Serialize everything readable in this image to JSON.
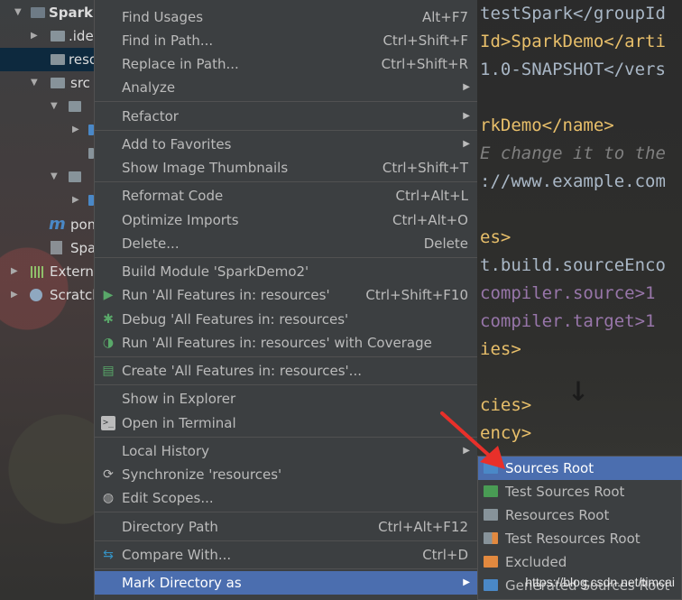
{
  "project_tree": {
    "items": [
      {
        "label": "SparkD",
        "icon": "project-folder-icon",
        "expanded": true,
        "selected": false
      },
      {
        "label": ".ide",
        "icon": "folder-icon",
        "expanded": false,
        "selected": false
      },
      {
        "label": "reso",
        "icon": "folder-icon",
        "expanded": false,
        "selected": true
      },
      {
        "label": "src",
        "icon": "folder-icon",
        "expanded": true,
        "selected": false
      },
      {
        "label": "pom",
        "icon": "maven-icon",
        "selected": false
      },
      {
        "label": "Spa",
        "icon": "file-icon",
        "selected": false
      },
      {
        "label": "Externa",
        "icon": "libraries-icon",
        "selected": false
      },
      {
        "label": "Scratch",
        "icon": "scratches-icon",
        "selected": false
      }
    ]
  },
  "editor": {
    "lines": [
      "testSpark</groupId",
      "Id>SparkDemo</arti",
      "1.0-SNAPSHOT</vers",
      "rkDemo</name>",
      "E change it to the",
      "://www.example.com",
      "es>",
      "t.build.sourceEnco",
      "compiler.source>1",
      "compiler.target>1",
      "ies>",
      "cies>",
      "ency>"
    ]
  },
  "context_menu": {
    "items": [
      {
        "label": "Find Usages",
        "shortcut": "Alt+F7"
      },
      {
        "label": "Find in Path...",
        "shortcut": "Ctrl+Shift+F"
      },
      {
        "label": "Replace in Path...",
        "shortcut": "Ctrl+Shift+R"
      },
      {
        "label": "Analyze",
        "shortcut": "",
        "submenu": true
      },
      {
        "label": "Refactor",
        "shortcut": "",
        "submenu": true
      },
      {
        "label": "Add to Favorites",
        "shortcut": "",
        "submenu": true
      },
      {
        "label": "Show Image Thumbnails",
        "shortcut": "Ctrl+Shift+T"
      },
      {
        "label": "Reformat Code",
        "shortcut": "Ctrl+Alt+L"
      },
      {
        "label": "Optimize Imports",
        "shortcut": "Ctrl+Alt+O"
      },
      {
        "label": "Delete...",
        "shortcut": "Delete"
      },
      {
        "label": "Build Module 'SparkDemo2'",
        "shortcut": ""
      },
      {
        "label": "Run 'All Features in: resources'",
        "shortcut": "Ctrl+Shift+F10",
        "icon": "run-icon"
      },
      {
        "label": "Debug 'All Features in: resources'",
        "shortcut": "",
        "icon": "debug-icon"
      },
      {
        "label": "Run 'All Features in: resources' with Coverage",
        "shortcut": "",
        "icon": "coverage-icon"
      },
      {
        "label": "Create 'All Features in: resources'...",
        "shortcut": "",
        "icon": "create-config-icon"
      },
      {
        "label": "Show in Explorer",
        "shortcut": ""
      },
      {
        "label": "Open in Terminal",
        "shortcut": "",
        "icon": "terminal-icon"
      },
      {
        "label": "Local History",
        "shortcut": "",
        "submenu": true
      },
      {
        "label": "Synchronize 'resources'",
        "shortcut": "",
        "icon": "sync-icon"
      },
      {
        "label": "Edit Scopes...",
        "shortcut": "",
        "icon": "scopes-icon"
      },
      {
        "label": "Directory Path",
        "shortcut": "Ctrl+Alt+F12"
      },
      {
        "label": "Compare With...",
        "shortcut": "Ctrl+D",
        "icon": "compare-icon"
      },
      {
        "label": "Mark Directory as",
        "shortcut": "",
        "submenu": true,
        "active": true
      }
    ]
  },
  "submenu": {
    "title": "Mark Directory as",
    "items": [
      {
        "label": "Sources Root",
        "icon": "sources-root-folder-icon",
        "color": "#4a88c7",
        "active": true
      },
      {
        "label": "Test Sources Root",
        "icon": "test-sources-root-folder-icon",
        "color": "#499c54"
      },
      {
        "label": "Resources Root",
        "icon": "resources-root-folder-icon",
        "color": "#87939a"
      },
      {
        "label": "Test Resources Root",
        "icon": "test-resources-root-folder-icon",
        "color": "#87939a"
      },
      {
        "label": "Excluded",
        "icon": "excluded-folder-icon",
        "color": "#e2893f"
      },
      {
        "label": "Generated Sources Root",
        "icon": "generated-sources-folder-icon",
        "color": "#4a88c7"
      }
    ]
  },
  "watermark": "https://blog.csdn.net/timcai",
  "colors": {
    "menu_bg": "#3c3f41",
    "menu_active": "#4b6eaf",
    "text": "#bbbbbb",
    "annotation_arrow": "#e8302a"
  }
}
